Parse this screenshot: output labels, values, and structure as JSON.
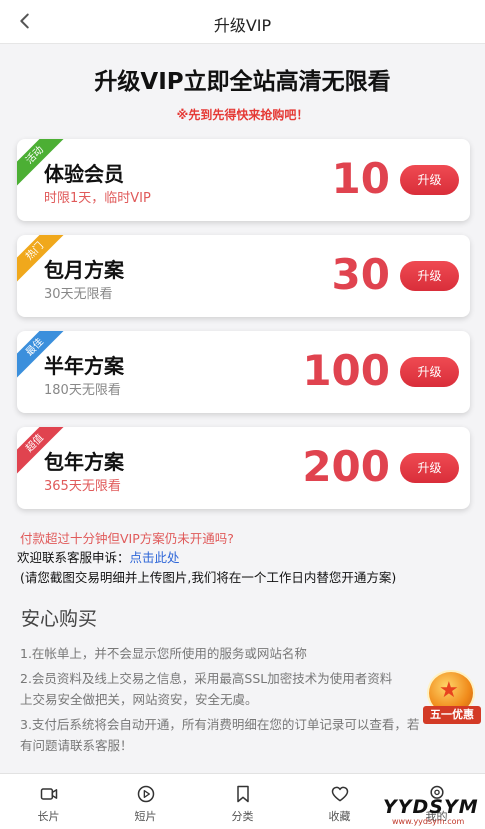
{
  "header": {
    "title": "升级VIP",
    "back_icon": "chevron-left-icon"
  },
  "hero": {
    "title": "升级VIP立即全站高清无限看",
    "subtitle": "※先到先得快来抢购吧！"
  },
  "plans": [
    {
      "tag": "活动",
      "tag_color": "#4caf34",
      "name": "体验会员",
      "desc": "时限1天，临时VIP",
      "price": "10",
      "button": "升级"
    },
    {
      "tag": "热门",
      "tag_color": "#f0a81c",
      "name": "包月方案",
      "desc": "30天无限看",
      "price": "30",
      "button": "升级"
    },
    {
      "tag": "最佳",
      "tag_color": "#3b8fdc",
      "name": "半年方案",
      "desc": "180天无限看",
      "price": "100",
      "button": "升级"
    },
    {
      "tag": "超值",
      "tag_color": "#e0434f",
      "name": "包年方案",
      "desc": "365天无限看",
      "price": "200",
      "button": "升级"
    }
  ],
  "help": {
    "question": "付款超过十分钟但VIP方案仍未开通吗?",
    "contact_prefix": "欢迎联系客服申诉：",
    "contact_link": "点击此处",
    "note": "(请您截图交易明细并上传图片,我们将在一个工作日内替您开通方案)"
  },
  "secure": {
    "title": "安心购买",
    "item1": "1.在帐单上，并不会显示您所使用的服务或网站名称",
    "item2a": "2.会员资料及线上交易之信息，采用最高SSL加密技术为使用者资料",
    "item2b": "上交易安全做把关，网站资安，安全无虞。",
    "item3a": "3.支付后系统将会自动开通，所有消费明细在您的订单记录可以查看，若",
    "item3b": "有问题请联系客服！"
  },
  "promo_badge": {
    "label": "五一优惠",
    "icon": "star-medal-icon"
  },
  "tabs": [
    {
      "label": "长片",
      "icon": "video-camera-icon"
    },
    {
      "label": "短片",
      "icon": "play-circle-icon"
    },
    {
      "label": "分类",
      "icon": "bookmark-icon"
    },
    {
      "label": "收藏",
      "icon": "heart-icon"
    },
    {
      "label": "我的",
      "icon": "user-icon"
    }
  ],
  "watermark": {
    "brand": "YYDSYM",
    "url": "www.yydsym.com"
  }
}
